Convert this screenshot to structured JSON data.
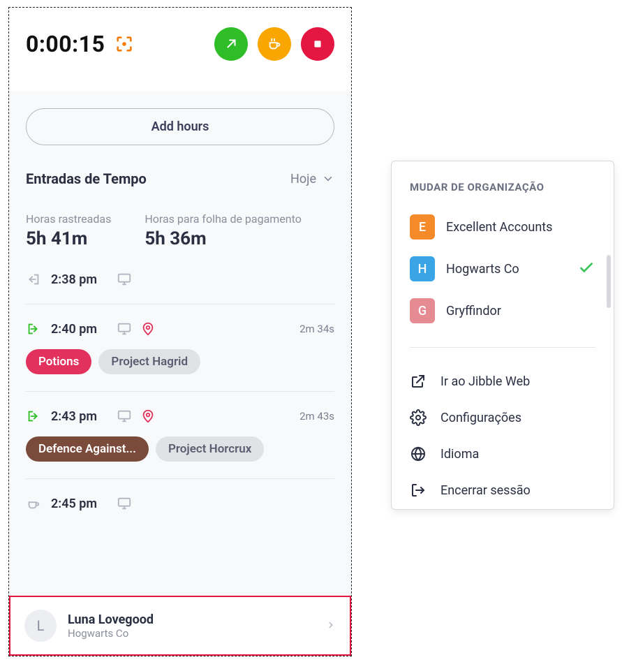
{
  "timer": "0:00:15",
  "add_hours_label": "Add hours",
  "section": {
    "title": "Entradas de Tempo",
    "filter_label": "Hoje"
  },
  "stats": {
    "tracked_label": "Horas rastreadas",
    "tracked_value": "5h 41m",
    "payroll_label": "Horas para folha de pagamento",
    "payroll_value": "5h 36m"
  },
  "entries": [
    {
      "time": "2:38 pm"
    },
    {
      "time": "2:40 pm",
      "duration": "2m 34s",
      "tag1": "Potions",
      "tag2": "Project Hagrid"
    },
    {
      "time": "2:43 pm",
      "duration": "2m 43s",
      "tag1": "Defence Against...",
      "tag2": "Project Horcrux"
    },
    {
      "time": "2:45 pm"
    }
  ],
  "footer": {
    "avatar_initial": "L",
    "name": "Luna Lovegood",
    "org": "Hogwarts Co"
  },
  "right": {
    "title": "MUDAR DE ORGANIZAÇÃO",
    "orgs": [
      {
        "initial": "E",
        "name": "Excellent Accounts"
      },
      {
        "initial": "H",
        "name": "Hogwarts Co"
      },
      {
        "initial": "G",
        "name": "Gryffindor"
      }
    ],
    "menu": {
      "web": "Ir ao Jibble Web",
      "settings": "Configurações",
      "language": "Idioma",
      "logout": "Encerrar sessão"
    }
  }
}
